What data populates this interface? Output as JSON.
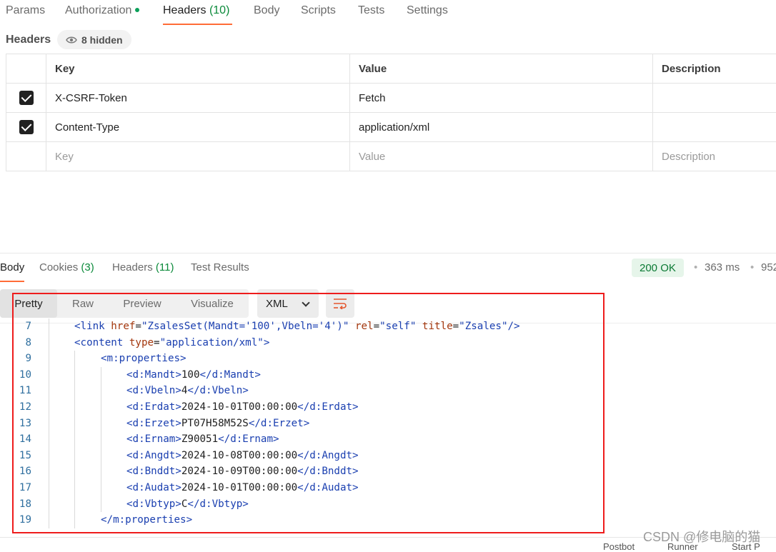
{
  "request_tabs": [
    {
      "label": "Params"
    },
    {
      "label": "Authorization",
      "dot": true
    },
    {
      "label": "Headers",
      "count": "(10)",
      "active": true
    },
    {
      "label": "Body"
    },
    {
      "label": "Scripts"
    },
    {
      "label": "Tests"
    },
    {
      "label": "Settings"
    }
  ],
  "headers_section": {
    "title": "Headers",
    "hidden_label": "8 hidden",
    "columns": [
      "Key",
      "Value",
      "Description"
    ],
    "rows": [
      {
        "checked": true,
        "key": "X-CSRF-Token",
        "value": "Fetch",
        "description": ""
      },
      {
        "checked": true,
        "key": "Content-Type",
        "value": "application/xml",
        "description": ""
      }
    ],
    "placeholders": {
      "key": "Key",
      "value": "Value",
      "description": "Description"
    }
  },
  "response": {
    "tabs": [
      {
        "label": "Body",
        "active": true
      },
      {
        "label": "Cookies",
        "count": "(3)"
      },
      {
        "label": "Headers",
        "count": "(11)"
      },
      {
        "label": "Test Results"
      }
    ],
    "status": "200 OK",
    "time": "363 ms",
    "size_partial": "952",
    "view_modes": [
      "Pretty",
      "Raw",
      "Preview",
      "Visualize"
    ],
    "format": "XML",
    "code_lines": [
      {
        "n": "7",
        "indent": 1,
        "parts": [
          [
            "tag",
            "<link "
          ],
          [
            "attr",
            "href"
          ],
          [
            "eq",
            "="
          ],
          [
            "str",
            "\"ZsalesSet(Mandt='100',Vbeln='4')\""
          ],
          [
            "eq",
            " "
          ],
          [
            "attr",
            "rel"
          ],
          [
            "eq",
            "="
          ],
          [
            "str",
            "\"self\""
          ],
          [
            "eq",
            " "
          ],
          [
            "attr",
            "title"
          ],
          [
            "eq",
            "="
          ],
          [
            "str",
            "\"Zsales\""
          ],
          [
            "tag",
            "/>"
          ]
        ]
      },
      {
        "n": "8",
        "indent": 1,
        "parts": [
          [
            "tag",
            "<content "
          ],
          [
            "attr",
            "type"
          ],
          [
            "eq",
            "="
          ],
          [
            "str",
            "\"application/xml\""
          ],
          [
            "tag",
            ">"
          ]
        ]
      },
      {
        "n": "9",
        "indent": 2,
        "parts": [
          [
            "tag",
            "<m:properties>"
          ]
        ]
      },
      {
        "n": "10",
        "indent": 3,
        "parts": [
          [
            "tag",
            "<d:Mandt>"
          ],
          [
            "val",
            "100"
          ],
          [
            "tag",
            "</d:Mandt>"
          ]
        ]
      },
      {
        "n": "11",
        "indent": 3,
        "parts": [
          [
            "tag",
            "<d:Vbeln>"
          ],
          [
            "val",
            "4"
          ],
          [
            "tag",
            "</d:Vbeln>"
          ]
        ]
      },
      {
        "n": "12",
        "indent": 3,
        "parts": [
          [
            "tag",
            "<d:Erdat>"
          ],
          [
            "val",
            "2024-10-01T00:00:00"
          ],
          [
            "tag",
            "</d:Erdat>"
          ]
        ]
      },
      {
        "n": "13",
        "indent": 3,
        "parts": [
          [
            "tag",
            "<d:Erzet>"
          ],
          [
            "val",
            "PT07H58M52S"
          ],
          [
            "tag",
            "</d:Erzet>"
          ]
        ]
      },
      {
        "n": "14",
        "indent": 3,
        "parts": [
          [
            "tag",
            "<d:Ernam>"
          ],
          [
            "val",
            "Z90051"
          ],
          [
            "tag",
            "</d:Ernam>"
          ]
        ]
      },
      {
        "n": "15",
        "indent": 3,
        "parts": [
          [
            "tag",
            "<d:Angdt>"
          ],
          [
            "val",
            "2024-10-08T00:00:00"
          ],
          [
            "tag",
            "</d:Angdt>"
          ]
        ]
      },
      {
        "n": "16",
        "indent": 3,
        "parts": [
          [
            "tag",
            "<d:Bnddt>"
          ],
          [
            "val",
            "2024-10-09T00:00:00"
          ],
          [
            "tag",
            "</d:Bnddt>"
          ]
        ]
      },
      {
        "n": "17",
        "indent": 3,
        "parts": [
          [
            "tag",
            "<d:Audat>"
          ],
          [
            "val",
            "2024-10-01T00:00:00"
          ],
          [
            "tag",
            "</d:Audat>"
          ]
        ]
      },
      {
        "n": "18",
        "indent": 3,
        "parts": [
          [
            "tag",
            "<d:Vbtyp>"
          ],
          [
            "val",
            "C"
          ],
          [
            "tag",
            "</d:Vbtyp>"
          ]
        ]
      },
      {
        "n": "19",
        "indent": 2,
        "parts": [
          [
            "tag",
            "</m:properties>"
          ]
        ]
      }
    ]
  },
  "footer": {
    "items": [
      "Postbot",
      "Runner",
      "Start P"
    ],
    "watermark": "CSDN @修电脑的猫"
  },
  "colors": {
    "accent": "#ff6c37",
    "status_green": "#0b7a34",
    "highlight_box": "#ee1c1c"
  }
}
